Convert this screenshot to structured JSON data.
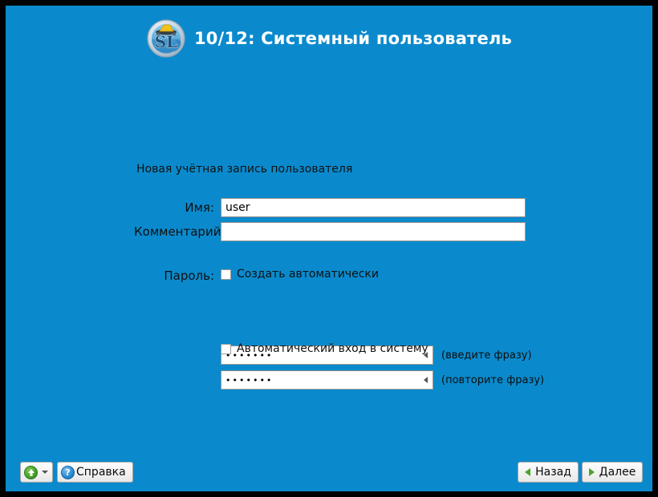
{
  "window": {
    "background_color": "#0a8acd",
    "border_color": "#000000"
  },
  "header": {
    "logo_icon": "sl-disc-logo-icon",
    "logo_text": "SL",
    "title": "10/12: Системный пользователь"
  },
  "content": {
    "intro": "Новая учётная запись пользователя",
    "fields": {
      "name": {
        "label": "Имя:",
        "value": "user",
        "placeholder": ""
      },
      "comment": {
        "label": "Комментарий:",
        "value": "",
        "placeholder": ""
      }
    },
    "password": {
      "label": "Пароль:",
      "auto_generate_checkbox": {
        "label": "Создать автоматически",
        "checked": false
      },
      "entry": {
        "value": "•••••••",
        "hint": "(введите фразу)",
        "marker_icon": "caps-indicator-icon"
      },
      "confirm": {
        "value": "•••••••",
        "hint": "(повторите фразу)",
        "marker_icon": "caps-indicator-icon"
      },
      "auto_login_checkbox": {
        "label": "Автоматический вход в систему",
        "checked": false
      }
    }
  },
  "bottom_bar": {
    "upload_button": {
      "label": "",
      "icon": "green-up-arrow-icon",
      "dropdown_icon": "caret-down-icon"
    },
    "help_button": {
      "label": "Справка",
      "icon": "question-mark-icon"
    },
    "back_button": {
      "label": "Назад",
      "icon": "green-left-arrow-icon"
    },
    "next_button": {
      "label": "Далее",
      "icon": "green-right-arrow-icon"
    }
  },
  "colors": {
    "accent_blue": "#0a8acd",
    "arrow_green": "#4ca22c",
    "help_blue": "#2f8fd4"
  }
}
